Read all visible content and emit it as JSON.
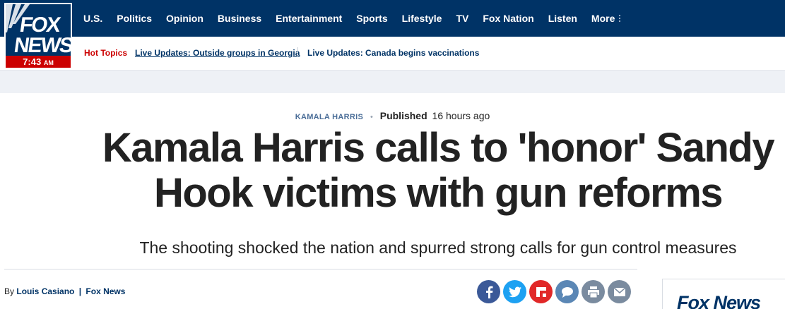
{
  "logo": {
    "line1": "FOX",
    "line2": "NEWS",
    "time": "7:43",
    "ampm": "AM"
  },
  "nav": {
    "items": [
      "U.S.",
      "Politics",
      "Opinion",
      "Business",
      "Entertainment",
      "Sports",
      "Lifestyle",
      "TV",
      "Fox Nation",
      "Listen"
    ],
    "more_label": "More"
  },
  "hot_topics": {
    "label": "Hot Topics",
    "links": [
      "Live Updates: Outside groups in Georgia",
      "Live Updates: Canada begins vaccinations"
    ]
  },
  "article": {
    "category": "KAMALA HARRIS",
    "published_label": "Published",
    "published_ago": "16 hours ago",
    "headline": "Kamala Harris calls to 'honor' Sandy Hook victims with gun reforms",
    "subhead": "The shooting shocked the nation and spurred strong calls for gun control measures",
    "byline_prefix": "By",
    "author": "Louis Casiano",
    "byline_sep": "|",
    "source": "Fox News"
  },
  "share": [
    {
      "icon": "facebook-icon",
      "color": "#3b5998"
    },
    {
      "icon": "twitter-icon",
      "color": "#1da1f2"
    },
    {
      "icon": "flipboard-icon",
      "color": "#e12828"
    },
    {
      "icon": "comments-icon",
      "color": "#5b87b5"
    },
    {
      "icon": "print-icon",
      "color": "#7a8b9f"
    },
    {
      "icon": "email-icon",
      "color": "#7a8b9f"
    }
  ],
  "sidebar": {
    "brand": "Fox News"
  },
  "colors": {
    "nav_bg": "#003366",
    "accent_red": "#cc0000",
    "band_gray": "#eef1f6"
  }
}
